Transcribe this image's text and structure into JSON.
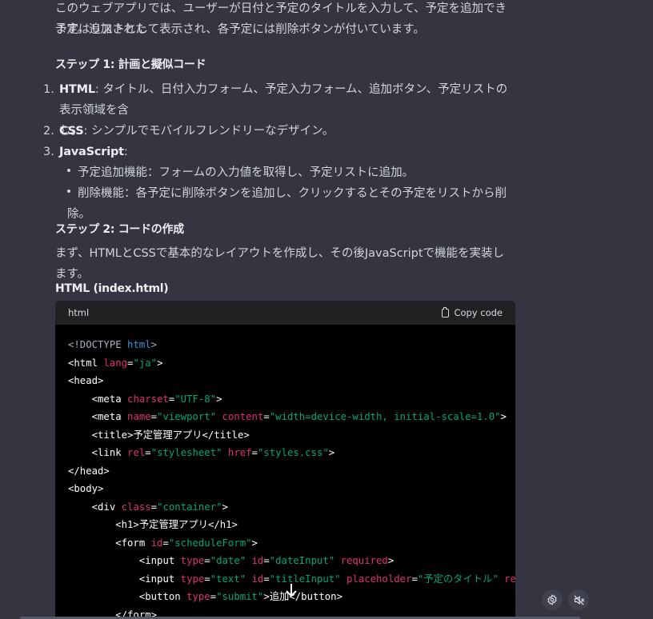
{
  "intro": {
    "line1": "このウェブアプリでは、ユーザーが日付と予定のタイトルを入力して、予定を追加できます。追加された",
    "line2": "予定はリストとして表示され、各予定には削除ボタンが付いています。"
  },
  "step1": {
    "heading": "ステップ 1: 計画と擬似コード",
    "items": [
      {
        "num": "1.",
        "label": "HTML",
        "text_a": ": タイトル、日付入力フォーム、予定入力フォーム、追加ボタン、予定リストの表示領域を含",
        "text_b": "む。"
      },
      {
        "num": "2.",
        "label": "CSS",
        "text_a": ": シンプルでモバイルフレンドリーなデザイン。"
      },
      {
        "num": "3.",
        "label": "JavaScript",
        "text_a": ":"
      }
    ],
    "subitems": [
      "予定追加機能：フォームの入力値を取得し、予定リストに追加。",
      "削除機能：各予定に削除ボタンを追加し、クリックするとその予定をリストから削除。"
    ]
  },
  "step2": {
    "heading": "ステップ 2: コードの作成",
    "text": "まず、HTMLとCSSで基本的なレイアウトを作成し、その後JavaScriptで機能を実装します。"
  },
  "code_section": {
    "heading": "HTML (index.html)",
    "language": "html",
    "copy_label": "Copy code",
    "lines": [
      [
        [
          "doc",
          "<!DOCTYPE "
        ],
        [
          "kw",
          "html"
        ],
        [
          "doc",
          ">"
        ]
      ],
      [
        [
          "tag",
          "<html "
        ],
        [
          "attr",
          "lang"
        ],
        [
          "tag",
          "="
        ],
        [
          "str",
          "\"ja\""
        ],
        [
          "tag",
          ">"
        ]
      ],
      [
        [
          "tag",
          "<head>"
        ]
      ],
      [
        [
          "tag",
          "    <meta "
        ],
        [
          "attr",
          "charset"
        ],
        [
          "tag",
          "="
        ],
        [
          "str",
          "\"UTF-8\""
        ],
        [
          "tag",
          ">"
        ]
      ],
      [
        [
          "tag",
          "    <meta "
        ],
        [
          "attr",
          "name"
        ],
        [
          "tag",
          "="
        ],
        [
          "str",
          "\"viewport\""
        ],
        [
          "tag",
          " "
        ],
        [
          "attr",
          "content"
        ],
        [
          "tag",
          "="
        ],
        [
          "str",
          "\"width=device-width, initial-scale=1.0\""
        ],
        [
          "tag",
          ">"
        ]
      ],
      [
        [
          "tag",
          "    <title>"
        ],
        [
          "txt",
          "予定管理アプリ"
        ],
        [
          "tag",
          "</title>"
        ]
      ],
      [
        [
          "tag",
          "    <link "
        ],
        [
          "attr",
          "rel"
        ],
        [
          "tag",
          "="
        ],
        [
          "str",
          "\"stylesheet\""
        ],
        [
          "tag",
          " "
        ],
        [
          "attr",
          "href"
        ],
        [
          "tag",
          "="
        ],
        [
          "str",
          "\"styles.css\""
        ],
        [
          "tag",
          ">"
        ]
      ],
      [
        [
          "tag",
          "</head>"
        ]
      ],
      [
        [
          "tag",
          "<body>"
        ]
      ],
      [
        [
          "tag",
          "    <div "
        ],
        [
          "attr",
          "class"
        ],
        [
          "tag",
          "="
        ],
        [
          "str",
          "\"container\""
        ],
        [
          "tag",
          ">"
        ]
      ],
      [
        [
          "tag",
          "        <h1>"
        ],
        [
          "txt",
          "予定管理アプリ"
        ],
        [
          "tag",
          "</h1>"
        ]
      ],
      [
        [
          "tag",
          "        <form "
        ],
        [
          "attr",
          "id"
        ],
        [
          "tag",
          "="
        ],
        [
          "str",
          "\"scheduleForm\""
        ],
        [
          "tag",
          ">"
        ]
      ],
      [
        [
          "tag",
          "            <input "
        ],
        [
          "attr",
          "type"
        ],
        [
          "tag",
          "="
        ],
        [
          "str",
          "\"date\""
        ],
        [
          "tag",
          " "
        ],
        [
          "attr",
          "id"
        ],
        [
          "tag",
          "="
        ],
        [
          "str",
          "\"dateInput\""
        ],
        [
          "tag",
          " "
        ],
        [
          "attr",
          "required"
        ],
        [
          "tag",
          ">"
        ]
      ],
      [
        [
          "tag",
          "            <input "
        ],
        [
          "attr",
          "type"
        ],
        [
          "tag",
          "="
        ],
        [
          "str",
          "\"text\""
        ],
        [
          "tag",
          " "
        ],
        [
          "attr",
          "id"
        ],
        [
          "tag",
          "="
        ],
        [
          "str",
          "\"titleInput\""
        ],
        [
          "tag",
          " "
        ],
        [
          "attr",
          "placeholder"
        ],
        [
          "tag",
          "="
        ],
        [
          "str",
          "\"予定のタイトル\""
        ],
        [
          "tag",
          " "
        ],
        [
          "attr",
          "required"
        ],
        [
          "tag",
          ">"
        ]
      ],
      [
        [
          "tag",
          "            <button "
        ],
        [
          "attr",
          "type"
        ],
        [
          "tag",
          "="
        ],
        [
          "str",
          "\"submit\""
        ],
        [
          "tag",
          ">"
        ],
        [
          "txt",
          "追加"
        ],
        [
          "tag",
          "</button>"
        ]
      ],
      [
        [
          "tag",
          "        </form>"
        ]
      ]
    ]
  },
  "icons": {
    "settings": "gear-icon",
    "speaker": "speaker-muted-icon",
    "scroll": "arrow-down-icon",
    "copy": "clipboard-icon"
  }
}
